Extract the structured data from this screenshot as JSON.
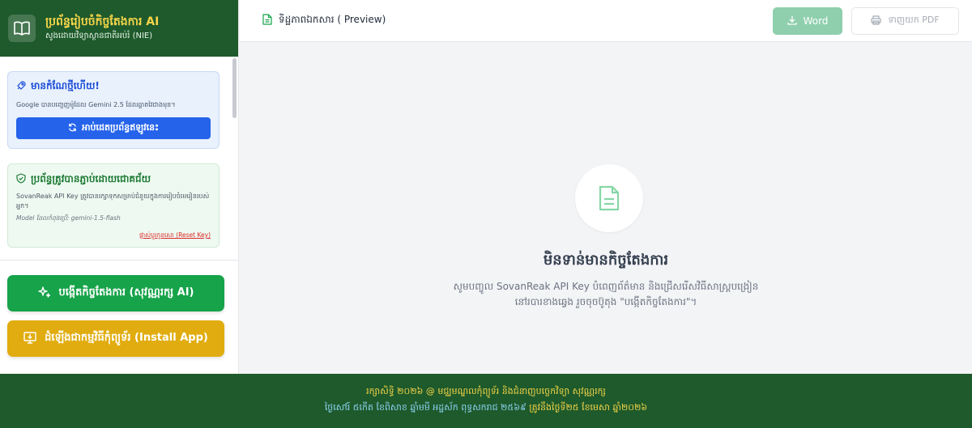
{
  "brand": {
    "title": "ប្រព័ន្ធរៀបចំកិច្ចតែងការ AI",
    "subtitle": "សូងដោយវិទ្យាស្ថានជាតិអប់រំ (NIE)",
    "icon": "book-open-icon"
  },
  "sidebar": {
    "update_card": {
      "title": "មានកំណែថ្មីហើយ!",
      "description": "Google បានបញ្ចេញម៉ូដែល Gemini 2.5 ដែលឆ្លាតវៃជាងមុន។",
      "button_label": "អាប់ដេតប្រព័ន្ធឥឡូវនេះ",
      "icon": "rocket-icon",
      "button_icon": "refresh-icon"
    },
    "secure_card": {
      "title": "ប្រព័ន្ធត្រូវបានភ្ជាប់ដោយជោគជ័យ",
      "description": "SovanReak API Key ត្រូវបានរក្សាទុកសម្រាប់ជំនួយក្នុងការរៀបចំមេរៀនរបស់អ្នក។",
      "model_note": "Model ដែលកំពុងប្រើ: gemini-1.5-flash",
      "reset_label": "ផ្លាស់ប្តូរកូនសោ (Reset Key)",
      "icon": "shield-check-icon"
    },
    "create_button": {
      "label": "បង្កើតកិច្ចតែងការ (សុវណ្ណរក្ស AI)",
      "icon": "sparkles-icon"
    },
    "install_button": {
      "label": "ដំឡើងជាកម្មវិធីកុំព្យូទ័រ (Install App)",
      "icon": "download-monitor-icon"
    }
  },
  "topbar": {
    "title": "ទិដ្ឋភាពឯកសារ ( Preview)",
    "title_icon": "document-icon",
    "word_label": "Word",
    "word_icon": "download-icon",
    "pdf_label": "ទាញយក PDF",
    "pdf_icon": "printer-icon"
  },
  "main": {
    "empty_icon": "document-icon",
    "empty_title": "មិនទាន់មានកិច្ចតែងការ",
    "empty_line1": "សូមបញ្ចូល SovanReak API Key បំពេញព័ត៌មាន និងជ្រើសរើសវិធីសាស្ត្របង្រៀន",
    "empty_line2": "នៅរបារខាងឆ្វេង រួចចុចប៊ូតុង \"បង្កើតកិច្ចតែងការ\"។"
  },
  "footer": {
    "line1": "រក្សាសិទ្ធិ ២០២៦ @ មជ្ឈមណ្ឌលកុំព្យូទ័រ និងជំនាញបច្ចេកវិទ្យា សុវណ្ណរក្ស",
    "line2_a": "ថ្ងៃសៅរ៍ ៥កើត ខែពិសាខ ឆ្នាំមមី អដ្ឋស័ក ពុទ្ធសករាជ ២៥៦៩",
    "line2_b": "ត្រូវនឹងថ្ងៃទី២៥ ខែមេសា ឆ្នាំ២០២៦"
  },
  "colors": {
    "brand_green": "#1e5a2b",
    "accent_yellow": "#f5d54a",
    "primary_blue": "#2563eb",
    "success_green": "#16a34a",
    "install_yellow": "#e1ac0f",
    "word_button": "#8fcfae"
  }
}
